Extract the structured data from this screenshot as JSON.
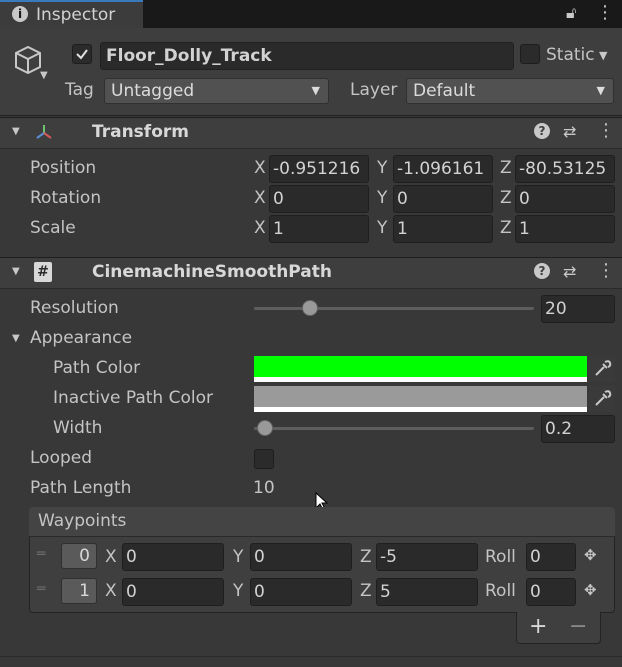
{
  "tab": {
    "title": "Inspector",
    "icon": "info-icon"
  },
  "object": {
    "name": "Floor_Dolly_Track",
    "static_label": "Static",
    "tag_label": "Tag",
    "tag_value": "Untagged",
    "layer_label": "Layer",
    "layer_value": "Default"
  },
  "transform": {
    "title": "Transform",
    "position": {
      "label": "Position",
      "x": "-0.951216",
      "y": "-1.096161",
      "z": "-80.53125"
    },
    "rotation": {
      "label": "Rotation",
      "x": "0",
      "y": "0",
      "z": "0"
    },
    "scale": {
      "label": "Scale",
      "x": "1",
      "y": "1",
      "z": "1"
    }
  },
  "axes": {
    "x": "X",
    "y": "Y",
    "z": "Z"
  },
  "smooth_path": {
    "title": "CinemachineSmoothPath",
    "resolution_label": "Resolution",
    "resolution_value": "20",
    "resolution_fraction": 0.2,
    "appearance_label": "Appearance",
    "path_color_label": "Path Color",
    "path_color": "#00ff00",
    "inactive_color_label": "Inactive Path Color",
    "inactive_color": "#9a9a9a",
    "width_label": "Width",
    "width_value": "0.2",
    "width_fraction": 0.04,
    "looped_label": "Looped",
    "path_length_label": "Path Length",
    "path_length_value": "10",
    "waypoints_label": "Waypoints",
    "roll_label": "Roll",
    "waypoints": [
      {
        "index": "0",
        "x": "0",
        "y": "0",
        "z": "-5",
        "roll": "0"
      },
      {
        "index": "1",
        "x": "0",
        "y": "0",
        "z": "5",
        "roll": "0"
      }
    ],
    "add_label": "+",
    "remove_label": "−"
  }
}
